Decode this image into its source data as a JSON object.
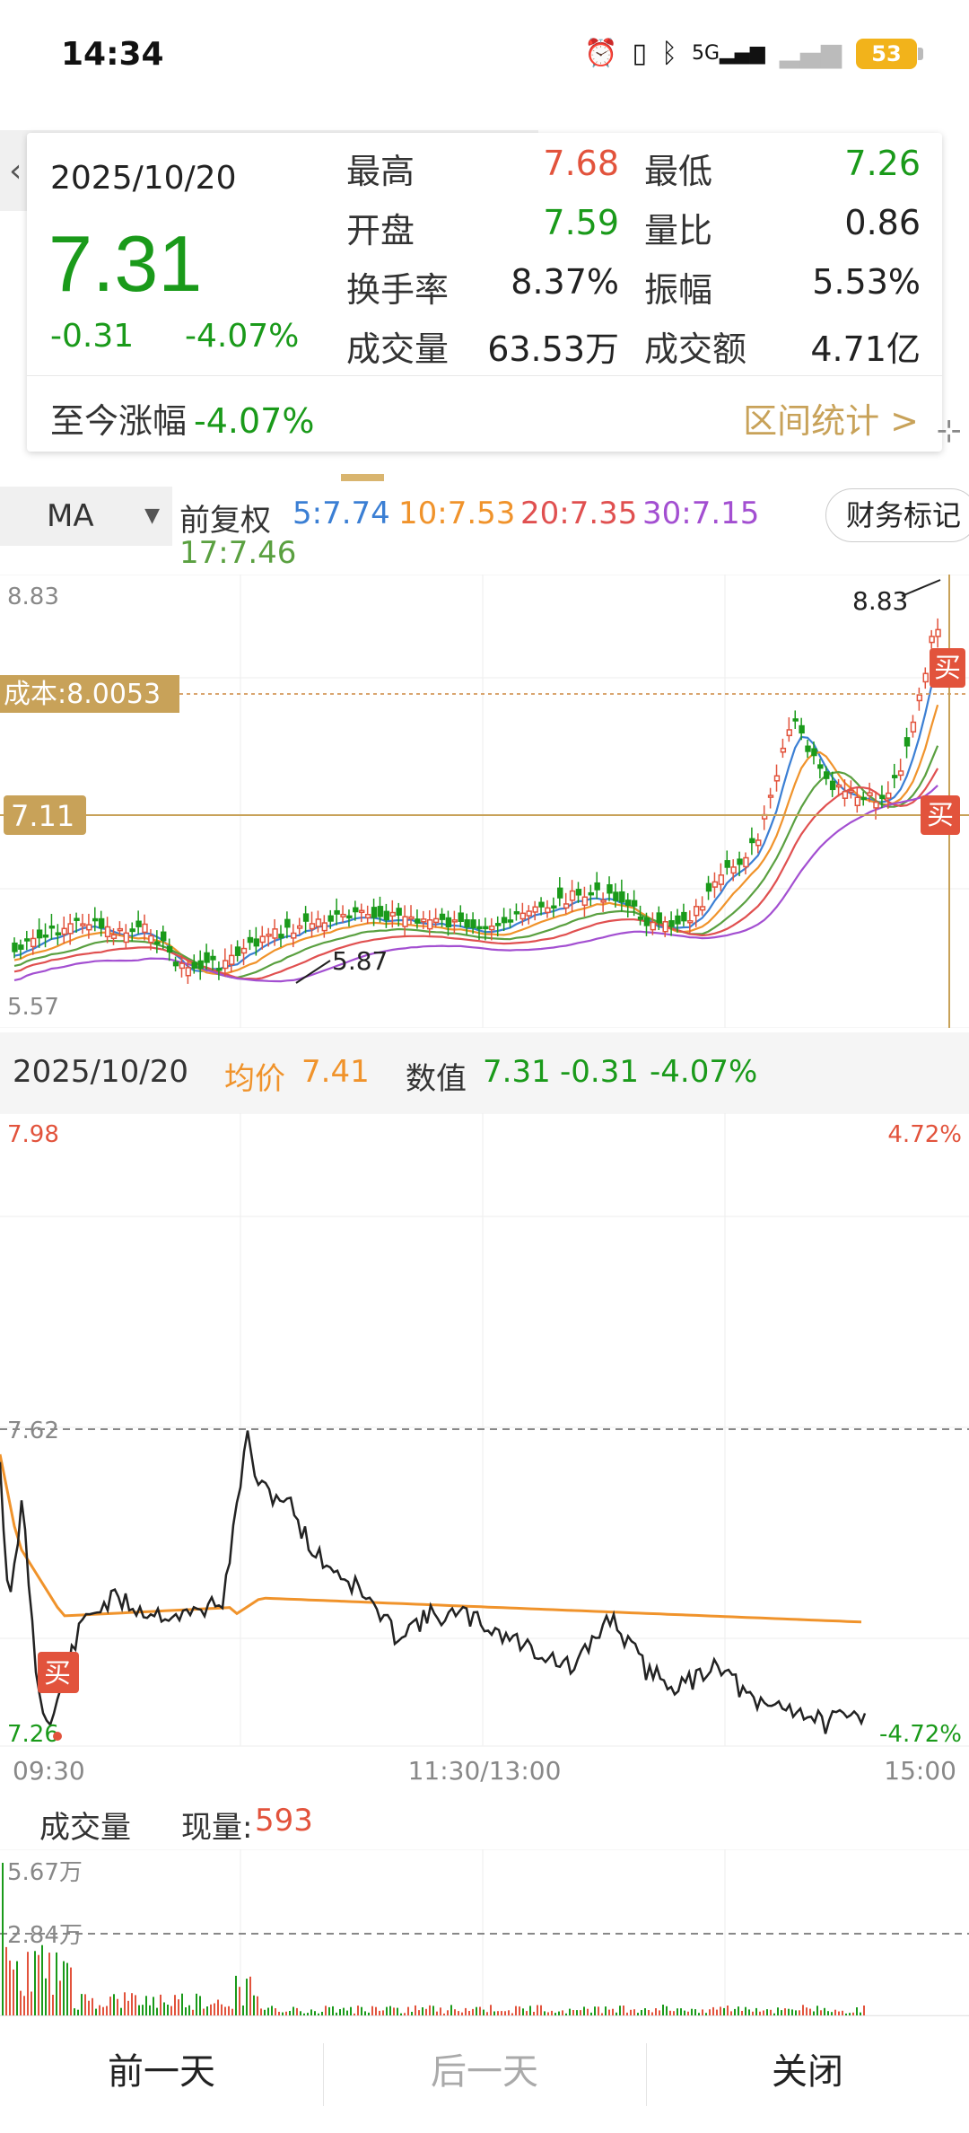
{
  "status": {
    "time": "14:34",
    "battery": "53",
    "network": "5G"
  },
  "card": {
    "date": "2025/10/20",
    "price": "7.31",
    "change": "-0.31",
    "change_pct": "-4.07%",
    "high_label": "最高",
    "high": "7.68",
    "low_label": "最低",
    "low": "7.26",
    "open_label": "开盘",
    "open": "7.59",
    "volratio_label": "量比",
    "volratio": "0.86",
    "turnover_label": "换手率",
    "turnover": "8.37%",
    "amplitude_label": "振幅",
    "amplitude": "5.53%",
    "volume_label": "成交量",
    "volume": "63.53万",
    "amount_label": "成交额",
    "amount": "4.71亿",
    "since_label": "至今涨幅",
    "since_value": "-4.07%",
    "range_stats": "区间统计 >"
  },
  "ma_bar": {
    "select": "MA",
    "adjust": "前复权",
    "ma5": "5:7.74",
    "ma10": "10:7.53",
    "ma20": "20:7.35",
    "ma30": "30:7.15",
    "ma17": "17:7.46",
    "finance_mark": "财务标记"
  },
  "kline": {
    "ymax_label": "8.83",
    "ymin_label": "5.57",
    "cost_label": "成本:8.0053",
    "price_tag": "7.11",
    "peak_label": "8.83",
    "trough_label": "5.87",
    "buy_label": "买"
  },
  "intraday": {
    "date": "2025/10/20",
    "avg_label": "均价",
    "avg_value": "7.41",
    "value_label": "数值",
    "value": "7.31",
    "value_change": "-0.31",
    "value_pct": "-4.07%",
    "y_top": "7.98",
    "y_top_pct": "4.72%",
    "y_mid": "7.62",
    "y_bottom": "7.26",
    "y_bottom_pct": "-4.72%",
    "t_start": "09:30",
    "t_mid": "11:30/13:00",
    "t_end": "15:00",
    "buy_label": "买"
  },
  "volume": {
    "title": "成交量",
    "current_label": "现量:",
    "current_value": "593",
    "y_top": "5.67万",
    "y_mid": "2.84万"
  },
  "bottom": {
    "prev": "前一天",
    "next": "后一天",
    "close": "关闭"
  },
  "colors": {
    "up": "#e2533c",
    "down": "#1a9a1a",
    "gold": "#c8a259",
    "ma5": "#3b7fd4",
    "ma10": "#f0932b",
    "ma20": "#e05050",
    "ma30": "#a34fd1",
    "ma17": "#5aa040"
  }
}
